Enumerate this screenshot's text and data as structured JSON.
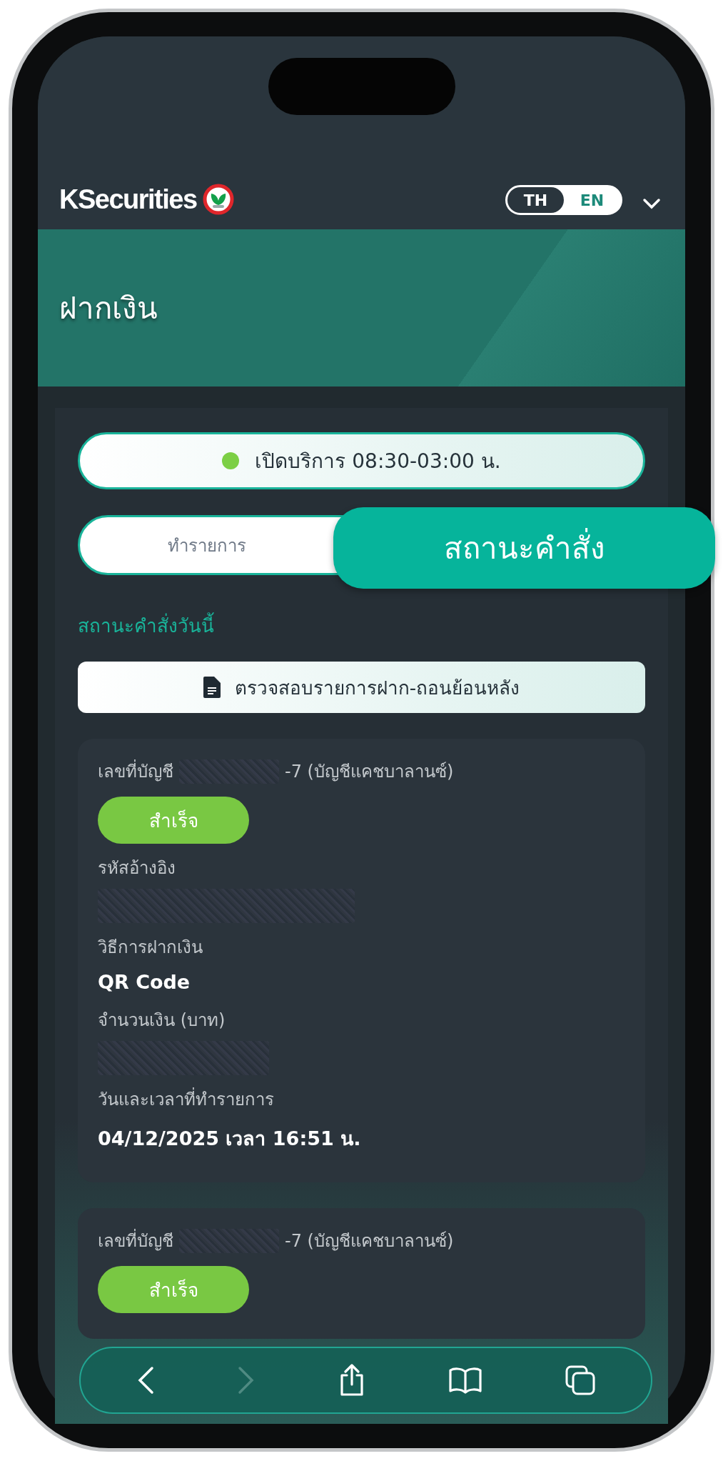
{
  "header": {
    "logo": "KSecurities",
    "languages": [
      {
        "label": "TH",
        "selected": true
      },
      {
        "label": "EN",
        "selected": false
      }
    ]
  },
  "page_title": "ฝากเงิน",
  "service_hours": {
    "text": "เปิดบริการ 08:30-03:00 น.",
    "open": true
  },
  "tabs": [
    {
      "label": "ทำรายการ",
      "selected": false
    },
    {
      "label": "สถานะคำสั่ง",
      "selected": true
    }
  ],
  "section_title": "สถานะคำสั่งวันนี้",
  "history_button": "ตรวจสอบรายการฝาก-ถอนย้อนหลัง",
  "orders": [
    {
      "account_label": "เลขที่บัญชี",
      "account_suffix": "-7 (บัญชีแคชบาลานซ์)",
      "status": "สำเร็จ",
      "fields": [
        {
          "label": "รหัสอ้างอิง",
          "kind": "masked"
        },
        {
          "label": "วิธีการฝากเงิน",
          "kind": "text",
          "value": "QR Code"
        },
        {
          "label": "จำนวนเงิน (บาท)",
          "kind": "masked"
        },
        {
          "label": "วันและเวลาที่ทำรายการ",
          "kind": "text",
          "value": "04/12/2025 เวลา 16:51 น."
        }
      ]
    },
    {
      "account_label": "เลขที่บัญชี",
      "account_suffix": "-7 (บัญชีแคชบาลานซ์)",
      "status": "สำเร็จ"
    }
  ],
  "browser_toolbar": {
    "back_disabled": false,
    "forward_disabled": true
  }
}
